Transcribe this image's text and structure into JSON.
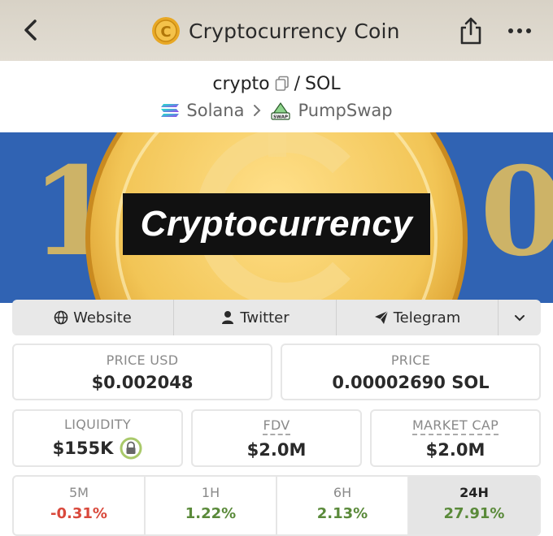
{
  "header": {
    "title": "Cryptocurrency Coin"
  },
  "pair": {
    "base": "crypto",
    "separator": "/",
    "quote": "SOL"
  },
  "chain": {
    "network": "Solana",
    "dex": "PumpSwap",
    "dex_icon_text": "SWAP"
  },
  "banner": {
    "title": "Cryptocurrency",
    "side_left": "1",
    "side_right": "0"
  },
  "links": [
    {
      "label": "Website",
      "icon": "globe-icon"
    },
    {
      "label": "Twitter",
      "icon": "user-icon"
    },
    {
      "label": "Telegram",
      "icon": "paper-plane-icon"
    }
  ],
  "stats": {
    "price_usd": {
      "label": "PRICE USD",
      "value": "$0.002048"
    },
    "price": {
      "label": "PRICE",
      "value": "0.00002690 SOL"
    },
    "liquidity": {
      "label": "LIQUIDITY",
      "value": "$155K"
    },
    "fdv": {
      "label": "FDV",
      "value": "$2.0M"
    },
    "market_cap": {
      "label": "MARKET CAP",
      "value": "$2.0M"
    }
  },
  "changes": [
    {
      "label": "5M",
      "value": "-0.31%",
      "color": "#d9483b"
    },
    {
      "label": "1H",
      "value": "1.22%",
      "color": "#5a8a3a"
    },
    {
      "label": "6H",
      "value": "2.13%",
      "color": "#5a8a3a"
    },
    {
      "label": "24H",
      "value": "27.91%",
      "color": "#5a8a3a",
      "active": true
    }
  ],
  "colors": {
    "header_bg": "#ddd7cc",
    "banner_blue": "#2c5fae",
    "coin_gold": "#f0c14a",
    "positive": "#5a8a3a",
    "negative": "#d9483b"
  }
}
